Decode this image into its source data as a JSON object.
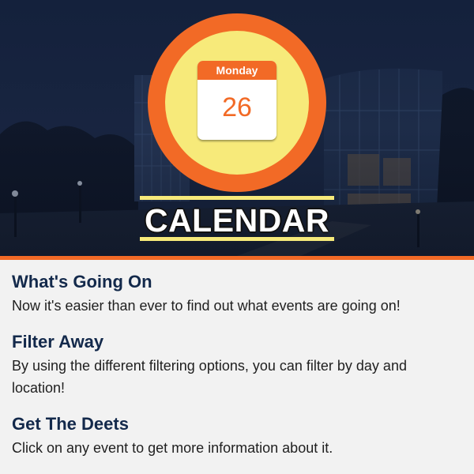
{
  "hero": {
    "calendar_day": "Monday",
    "calendar_date": "26",
    "title": "CALENDAR"
  },
  "colors": {
    "accent_orange": "#f26a26",
    "accent_yellow": "#f7ea7a",
    "heading_navy": "#13294b"
  },
  "sections": [
    {
      "heading": "What's Going On",
      "body": "Now it's easier than ever to find out what events are going on!"
    },
    {
      "heading": "Filter Away",
      "body": "By using the different filtering options, you can filter by day and location!"
    },
    {
      "heading": "Get The Deets",
      "body": "Click on any event to get more information about it."
    }
  ]
}
